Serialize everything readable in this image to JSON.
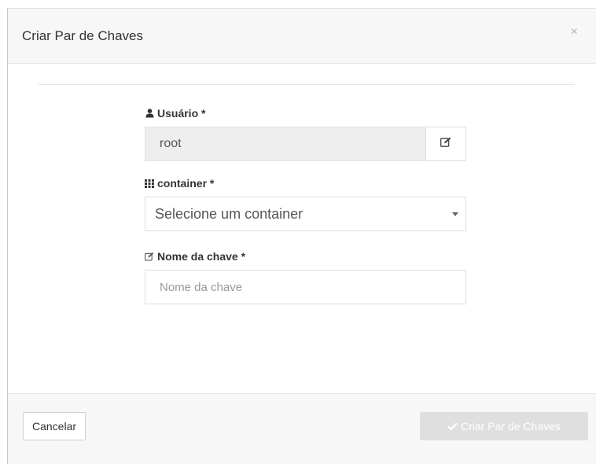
{
  "modal": {
    "title": "Criar Par de Chaves",
    "close_symbol": "×"
  },
  "form": {
    "user": {
      "label": "Usuário *",
      "icon": "user-icon",
      "value": "root",
      "edit_icon": "edit-icon"
    },
    "container": {
      "label": "container *",
      "icon": "grid-icon",
      "selected": "Selecione um container"
    },
    "key_name": {
      "label": "Nome da chave *",
      "icon": "edit-icon",
      "placeholder": "Nome da chave",
      "value": ""
    }
  },
  "footer": {
    "cancel_label": "Cancelar",
    "submit_label": "Criar Par de Chaves",
    "submit_icon": "check-icon",
    "submit_disabled": true
  },
  "colors": {
    "header_bg": "#f7f7f7",
    "readonly_bg": "#eeeeee",
    "disabled_button_bg": "#dfdfdf"
  }
}
